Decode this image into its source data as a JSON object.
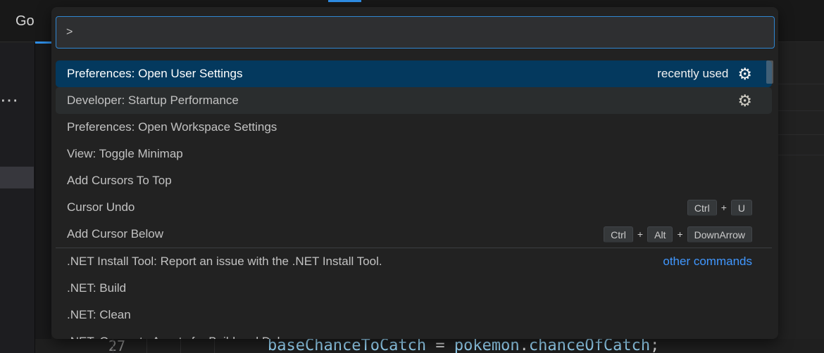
{
  "menu_bar": {
    "items": [
      {
        "label": "Go"
      }
    ]
  },
  "left_panel": {
    "more_icon": "⋯"
  },
  "command_palette": {
    "input": {
      "value": ">",
      "placeholder": ""
    },
    "items": [
      {
        "label": "Preferences: Open User Settings",
        "selected": true,
        "meta": "recently used",
        "gear": true
      },
      {
        "label": "Developer: Startup Performance",
        "subtle": true,
        "gear": true
      },
      {
        "label": "Preferences: Open Workspace Settings"
      },
      {
        "label": "View: Toggle Minimap"
      },
      {
        "label": "Add Cursors To Top"
      },
      {
        "label": "Cursor Undo",
        "keys": [
          "Ctrl",
          "U"
        ]
      },
      {
        "label": "Add Cursor Below",
        "keys": [
          "Ctrl",
          "Alt",
          "DownArrow"
        ],
        "separator_after": true
      },
      {
        "label": ".NET Install Tool: Report an issue with the .NET Install Tool.",
        "link": "other commands"
      },
      {
        "label": ".NET: Build"
      },
      {
        "label": ".NET: Clean"
      },
      {
        "label": ".NET: Generate Assets for Build and Debug"
      }
    ]
  },
  "editor": {
    "line_number": "27",
    "code_tokens": [
      {
        "text": "baseChanceToCatch",
        "color": "#9cdcfe"
      },
      {
        "text": " ",
        "color": "#d4d4d4"
      },
      {
        "text": "=",
        "color": "#d4d4d4"
      },
      {
        "text": " ",
        "color": "#d4d4d4"
      },
      {
        "text": "pokemon",
        "color": "#9cdcfe"
      },
      {
        "text": ".",
        "color": "#d4d4d4"
      },
      {
        "text": "chanceOfCatch",
        "color": "#9cdcfe"
      },
      {
        "text": ";",
        "color": "#d4d4d4"
      }
    ]
  },
  "colors": {
    "accent": "#2f8fe8",
    "selection_background": "#04395e",
    "link": "#4097ff",
    "palette_background": "#222222",
    "menu_background": "#181818"
  },
  "icons": {
    "gear": "⚙",
    "more": "⋯"
  }
}
